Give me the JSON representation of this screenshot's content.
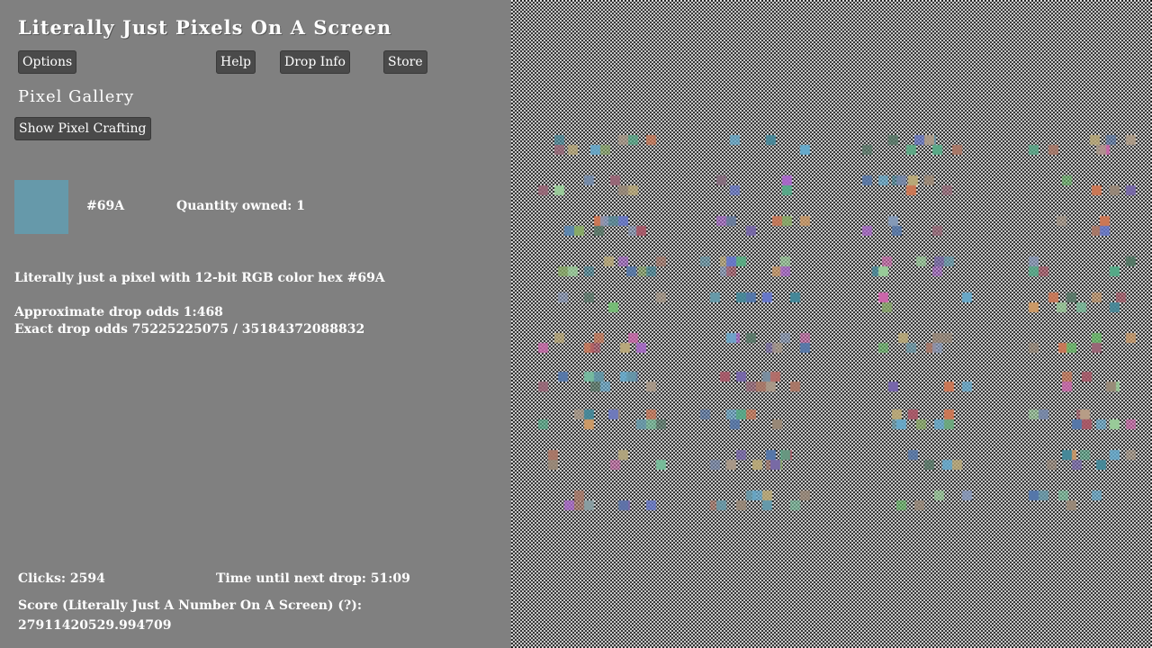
{
  "app": {
    "title": "Literally Just Pixels On A Screen"
  },
  "toolbar": {
    "options_label": "Options",
    "help_label": "Help",
    "drop_info_label": "Drop Info",
    "store_label": "Store"
  },
  "gallery": {
    "heading": "Pixel Gallery",
    "crafting_button_label": "Show Pixel Crafting",
    "selected": {
      "hex": "#69A",
      "swatch_color": "#6699aa",
      "quantity_label": "Quantity owned:",
      "quantity": "1",
      "description": "Literally just a pixel with 12-bit RGB color hex #69A",
      "approx_odds": "Approximate drop odds 1:468",
      "exact_odds": "Exact drop odds 75225225075 / 35184372088832"
    }
  },
  "stats": {
    "clicks": "Clicks: 2594",
    "next_drop": "Time until next drop: 51:09",
    "score_label": "Score (Literally Just A Number On A Screen) (?):",
    "score_value": "27911420529.994709"
  },
  "colors": {
    "background": "#808080",
    "button": "#4a4a4a",
    "checker_dark": "#000000",
    "checker_light": "#ffffff"
  }
}
